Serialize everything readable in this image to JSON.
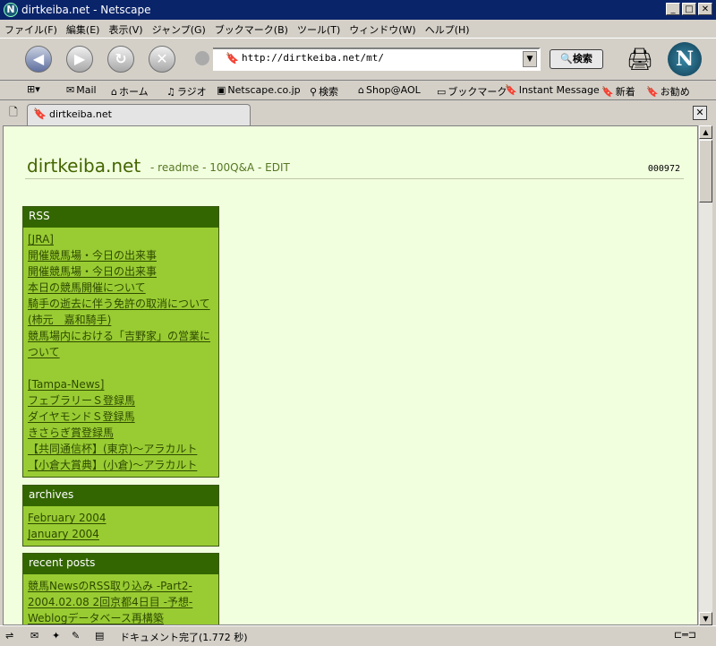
{
  "window": {
    "title": "dirtkeiba.net - Netscape"
  },
  "menu": [
    "ファイル(F)",
    "編集(E)",
    "表示(V)",
    "ジャンプ(G)",
    "ブックマーク(B)",
    "ツール(T)",
    "ウィンドウ(W)",
    "ヘルプ(H)"
  ],
  "nav": {
    "url": "http://dirtkeiba.net/mt/",
    "search_label": "検索"
  },
  "personal_toolbar": [
    "Mail",
    "ホーム",
    "ラジオ",
    "Netscape.co.jp",
    "検索",
    "Shop@AOL",
    "ブックマーク",
    "Instant Message",
    "新着",
    "お勧め"
  ],
  "tab": {
    "label": "dirtkeiba.net"
  },
  "page": {
    "site_title": "dirtkeiba.net",
    "nav_links": {
      "readme": "readme",
      "qa": "100Q&A",
      "edit": "EDIT"
    },
    "counter": "000972",
    "rss": {
      "title": "RSS",
      "group1_label": "[JRA]",
      "group1": [
        "開催競馬場・今日の出来事",
        "開催競馬場・今日の出来事",
        "本日の競馬開催について",
        "騎手の逝去に伴う免許の取消について(柿元　嘉和騎手)",
        "競馬場内における「吉野家」の営業について"
      ],
      "group2_label": "[Tampa-News]",
      "group2": [
        "フェブラリーＳ登録馬",
        "ダイヤモンドＳ登録馬",
        "きさらぎ賞登録馬",
        "【共同通信杯】(東京)〜アラカルト",
        "【小倉大賞典】(小倉)〜アラカルト"
      ]
    },
    "archives": {
      "title": "archives",
      "items": [
        "February 2004",
        "January 2004"
      ]
    },
    "recent": {
      "title": "recent posts",
      "items": [
        "競馬NewsのRSS取り込み -Part2-",
        "2004.02.08 2回京都4日目 -予想-",
        "Weblogデータベース再構築"
      ]
    }
  },
  "status": {
    "message": "ドキュメント完了(1.772 秒)"
  }
}
